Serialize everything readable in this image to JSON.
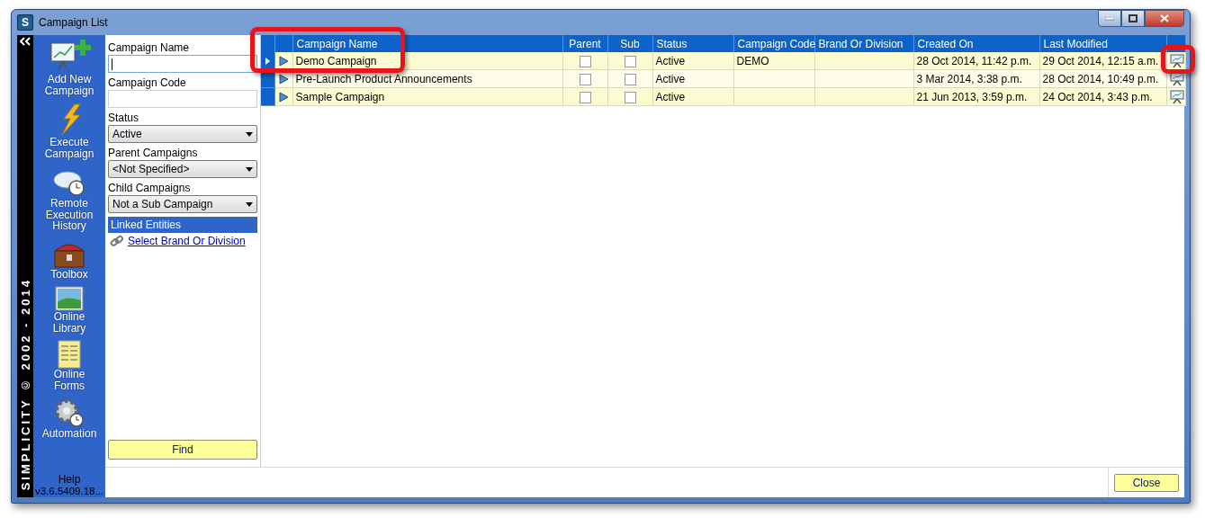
{
  "window": {
    "app_icon": "S",
    "title": "Campaign List"
  },
  "brand_strip": "SIMPLICITY © 2002 - 2014",
  "sidebar": {
    "items": [
      {
        "kind": "add",
        "label": "Add New Campaign"
      },
      {
        "kind": "execute",
        "label": "Execute Campaign"
      },
      {
        "kind": "history",
        "label": "Remote Execution History"
      },
      {
        "kind": "toolbox",
        "label": "Toolbox"
      },
      {
        "kind": "library",
        "label": "Online Library"
      },
      {
        "kind": "forms",
        "label": "Online Forms"
      },
      {
        "kind": "automation",
        "label": "Automation"
      }
    ],
    "help": "Help",
    "version": "v3.6.5409.18..."
  },
  "filters": {
    "fields": [
      {
        "kind": "text",
        "label": "Campaign Name",
        "focused": true
      },
      {
        "kind": "text",
        "label": "Campaign Code",
        "focused": false
      },
      {
        "kind": "combo",
        "label": "Status",
        "value": "Active"
      },
      {
        "kind": "combo",
        "label": "Parent Campaigns",
        "value": "<Not Specified>"
      },
      {
        "kind": "combo",
        "label": "Child Campaigns",
        "value": "Not a Sub Campaign"
      }
    ],
    "linked": {
      "title": "Linked Entities",
      "link": "Select Brand Or Division"
    },
    "find_button": "Find"
  },
  "table": {
    "columns": [
      "Campaign Name",
      "Parent",
      "Sub",
      "Status",
      "Campaign Code",
      "Brand Or Division",
      "Created On",
      "Last Modified"
    ],
    "rows": [
      {
        "selected": true,
        "name": "Demo Campaign",
        "parent": false,
        "sub": false,
        "status": "Active",
        "code": "DEMO",
        "created": "28 Oct 2014, 11:42 p.m.",
        "modified": "29 Oct 2014, 12:15 a.m."
      },
      {
        "selected": false,
        "name": "Pre-Launch Product Announcements",
        "parent": false,
        "sub": false,
        "status": "Active",
        "created": "3 Mar 2014, 3:38 p.m.",
        "modified": "28 Oct 2014, 10:49 p.m."
      },
      {
        "selected": false,
        "name": "Sample Campaign",
        "parent": false,
        "sub": false,
        "status": "Active",
        "created": "21 Jun 2013, 3:59 p.m.",
        "modified": "24 Oct 2014, 3:43 p.m."
      }
    ]
  },
  "close_button": "Close"
}
